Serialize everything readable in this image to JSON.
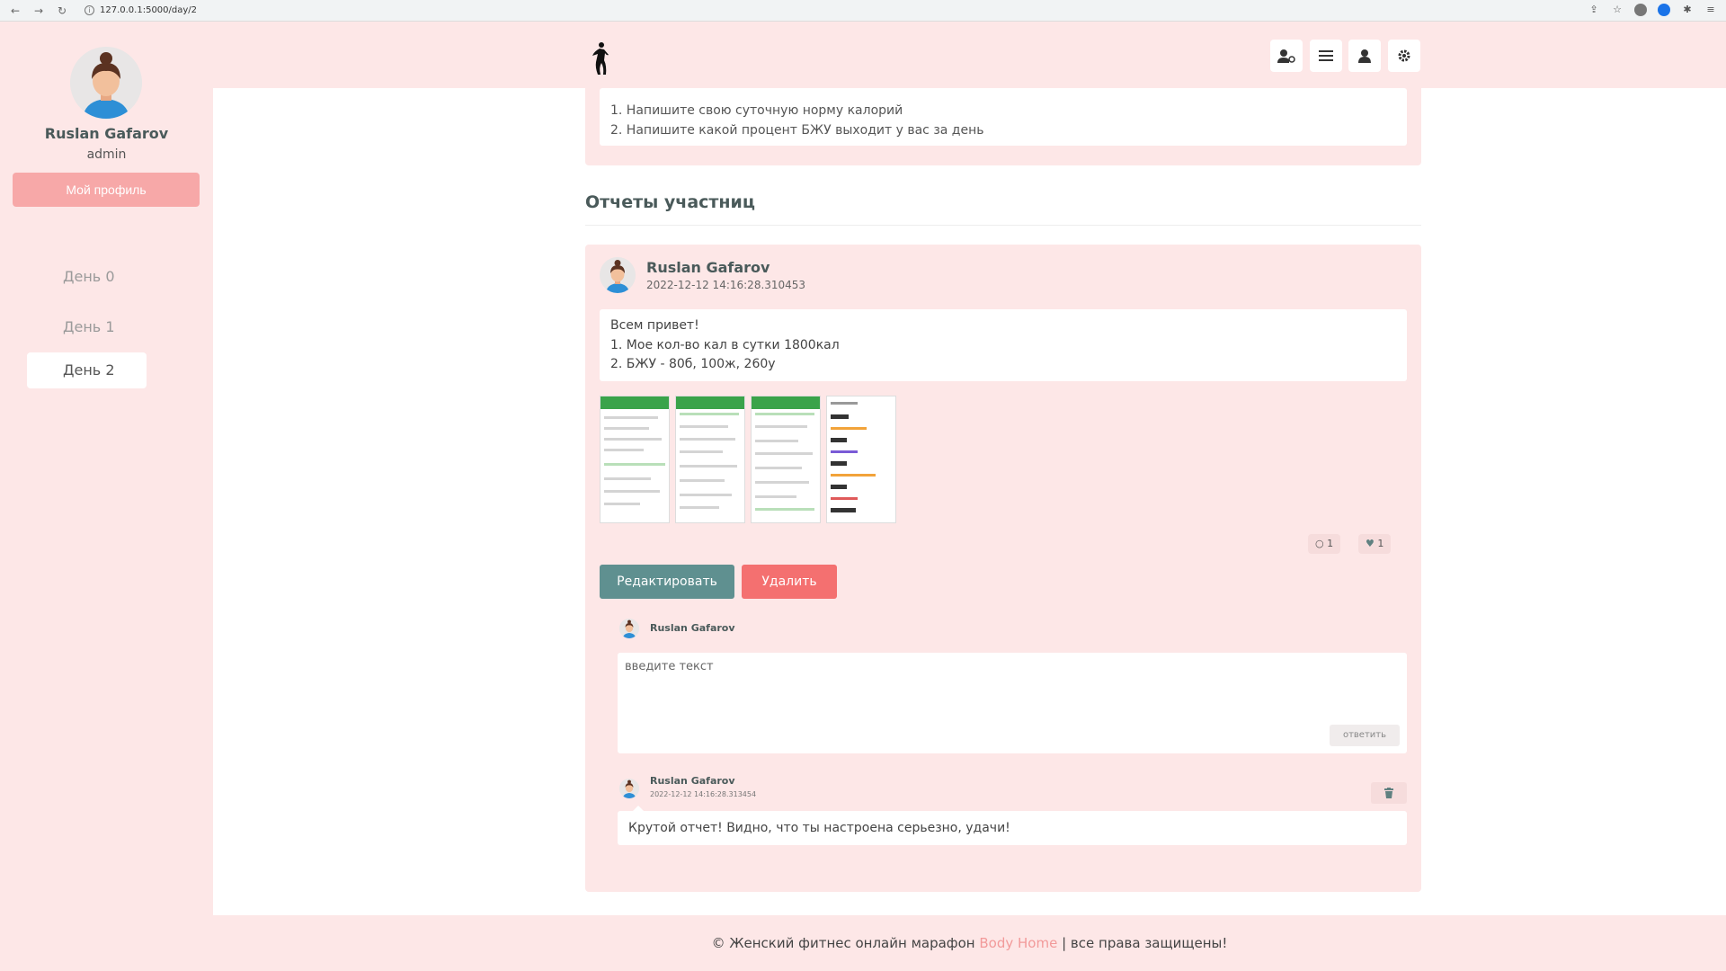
{
  "browser": {
    "url": "127.0.0.1:5000/day/2"
  },
  "sidebar": {
    "name": "Ruslan Gafarov",
    "role": "admin",
    "profile_button": "Мой профиль",
    "days": [
      {
        "label": "День 0"
      },
      {
        "label": "День 1"
      },
      {
        "label": "День 2"
      }
    ]
  },
  "task": {
    "lines": [
      "1. Напишите свою суточную норму калорий",
      "2. Напишите какой процент БЖУ выходит у вас за день"
    ]
  },
  "reports_title": "Отчеты участниц",
  "post": {
    "author": "Ruslan Gafarov",
    "date": "2022-12-12 14:16:28.310453",
    "lines": [
      "Всем привет!",
      "1. Мое кол-во кал в сутки 1800кал",
      "2. БЖУ - 80б, 100ж, 260у"
    ],
    "comments_count": "1",
    "likes_count": "1",
    "edit_button": "Редактировать",
    "delete_button": "Удалить"
  },
  "reply": {
    "author": "Ruslan Gafarov",
    "placeholder": "введите текст",
    "submit": "ответить"
  },
  "comment": {
    "author": "Ruslan Gafarov",
    "date": "2022-12-12 14:16:28.313454",
    "text": "Крутой отчет! Видно, что ты настроена серьезно, удачи!"
  },
  "footer": {
    "prefix": "© Женский фитнес онлайн марафон",
    "brand": "Body Home",
    "suffix": "| все права защищены!"
  },
  "colors": {
    "pink_bg": "#fde7e7",
    "accent_pink": "#f7a8a8",
    "teal_button": "#5f9090",
    "red_button": "#f47070"
  }
}
